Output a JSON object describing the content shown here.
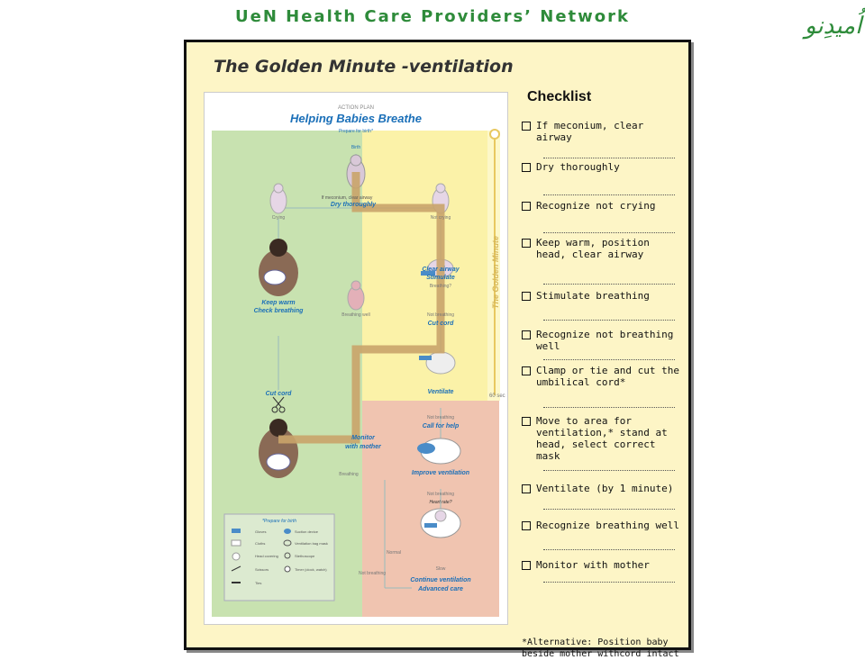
{
  "header": {
    "title": "UeN Health Care Providers’ Network",
    "logo_text": "اُمیدِنو"
  },
  "slide": {
    "title": "The Golden Minute -ventilation"
  },
  "poster": {
    "small_title": "ACTION PLAN",
    "title": "Helping Babies Breathe",
    "prepare": "Prepare for birth*",
    "birth": "Birth",
    "meconium": "If meconium, clear airway",
    "dry": "Dry thoroughly",
    "crying": "Crying",
    "not_crying": "Not crying",
    "keep_warm": "Keep warm",
    "check_breathing": "Check breathing",
    "clear_airway": "Clear airway",
    "stimulate": "Stimulate",
    "breathing_q": "Breathing?",
    "breathing_well": "Breathing well",
    "not_breathing": "Not breathing",
    "cut_cord_right": "Cut cord",
    "cut_cord": "Cut cord",
    "ventilate": "Ventilate",
    "not_breathing_2": "Not breathing",
    "call_help": "Call for help",
    "monitor": "Monitor",
    "with_mother": "with mother",
    "breathing": "Breathing",
    "improve_ventilation": "Improve ventilation",
    "not_breathing_3": "Not breathing",
    "heart_rate": "Heart rate?",
    "normal": "Normal",
    "slow": "Slow",
    "not_breathing_4": "Not breathing",
    "continue_ventilation": "Continue ventilation",
    "advanced_care": "Advanced care",
    "golden_minute": "The Golden Minute",
    "sixty_sec": "60 sec",
    "prepare_box": "*Prepare for birth",
    "supplies": [
      "Gloves",
      "Suction device",
      "Cloths",
      "Ventilation bag mask",
      "Head covering",
      "Stethoscope",
      "Scissors",
      "Timer (clock, watch)",
      "Ties"
    ]
  },
  "checklist": {
    "title": "Checklist",
    "items": [
      "If meconium, clear airway",
      "Dry thoroughly",
      "Recognize not crying",
      "Keep warm, position head, clear airway",
      "Stimulate breathing",
      "Recognize   not breathing   well",
      "Clamp or tie and cut the umbilical cord*",
      "Move to area for ventilation,* stand at head, select correct mask",
      "Ventilate (by 1 minute)",
      "Recognize breathing well",
      "Monitor with mother"
    ],
    "note": "*Alternative: Position baby beside mother withcord intact"
  },
  "colors": {
    "header_green": "#2e8b3a",
    "panel_bg": "#fdf5c6",
    "zone_green": "#c8e2b0",
    "zone_yellow": "#fbf2a8",
    "zone_red": "#f0c4b0",
    "path": "#c9a46a",
    "poster_blue": "#1a6fb8"
  }
}
